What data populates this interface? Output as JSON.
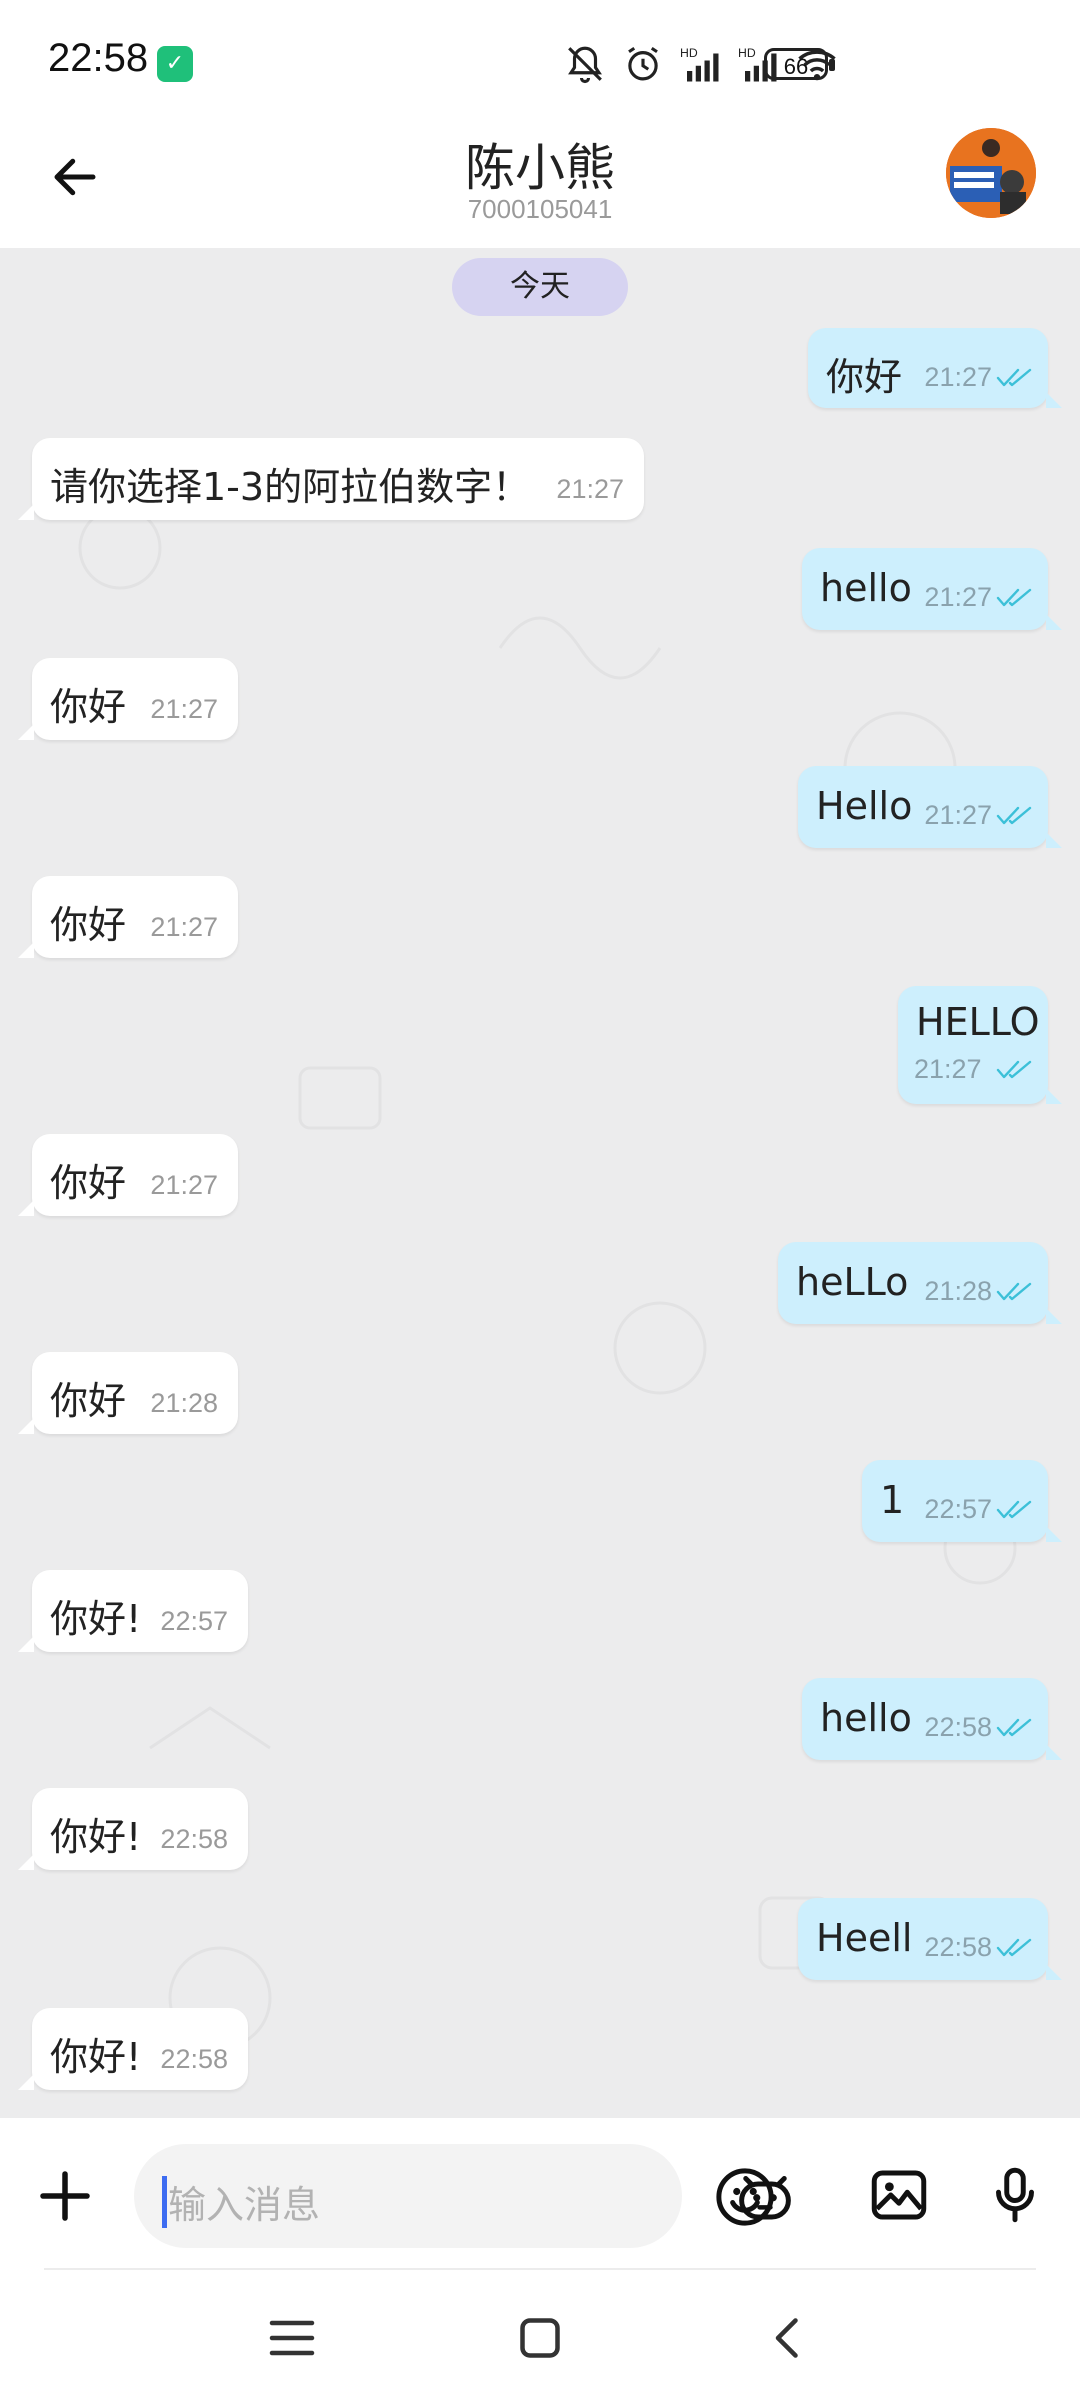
{
  "status": {
    "time": "22:58",
    "battery": "66"
  },
  "header": {
    "name": "陈小熊",
    "id": "7000105041"
  },
  "chat": {
    "date_label": "今天",
    "messages": [
      {
        "dir": "out",
        "text": "你好",
        "time": "21:27"
      },
      {
        "dir": "in",
        "text": "请你选择1-3的阿拉伯数字！",
        "time": "21:27"
      },
      {
        "dir": "out",
        "text": "hello",
        "time": "21:27"
      },
      {
        "dir": "in",
        "text": "你好",
        "time": "21:27"
      },
      {
        "dir": "out",
        "text": "Hello",
        "time": "21:27"
      },
      {
        "dir": "in",
        "text": "你好",
        "time": "21:27"
      },
      {
        "dir": "out",
        "text": "HELLO",
        "time": "21:27"
      },
      {
        "dir": "in",
        "text": "你好",
        "time": "21:27"
      },
      {
        "dir": "out",
        "text": "heLLo",
        "time": "21:28"
      },
      {
        "dir": "in",
        "text": "你好",
        "time": "21:28"
      },
      {
        "dir": "out",
        "text": "1",
        "time": "22:57"
      },
      {
        "dir": "in",
        "text": "你好!",
        "time": "22:57"
      },
      {
        "dir": "out",
        "text": "hello",
        "time": "22:58"
      },
      {
        "dir": "in",
        "text": "你好!",
        "time": "22:58"
      },
      {
        "dir": "out",
        "text": "Heell",
        "time": "22:58"
      },
      {
        "dir": "in",
        "text": "你好!",
        "time": "22:58"
      }
    ]
  },
  "input": {
    "placeholder": "输入消息"
  },
  "colors": {
    "outgoing_bubble": "#cdeffd",
    "incoming_bubble": "#ffffff",
    "chat_background": "#ececed",
    "date_pill": "#d6d3f1",
    "read_ticks": "#3cc0d8"
  }
}
